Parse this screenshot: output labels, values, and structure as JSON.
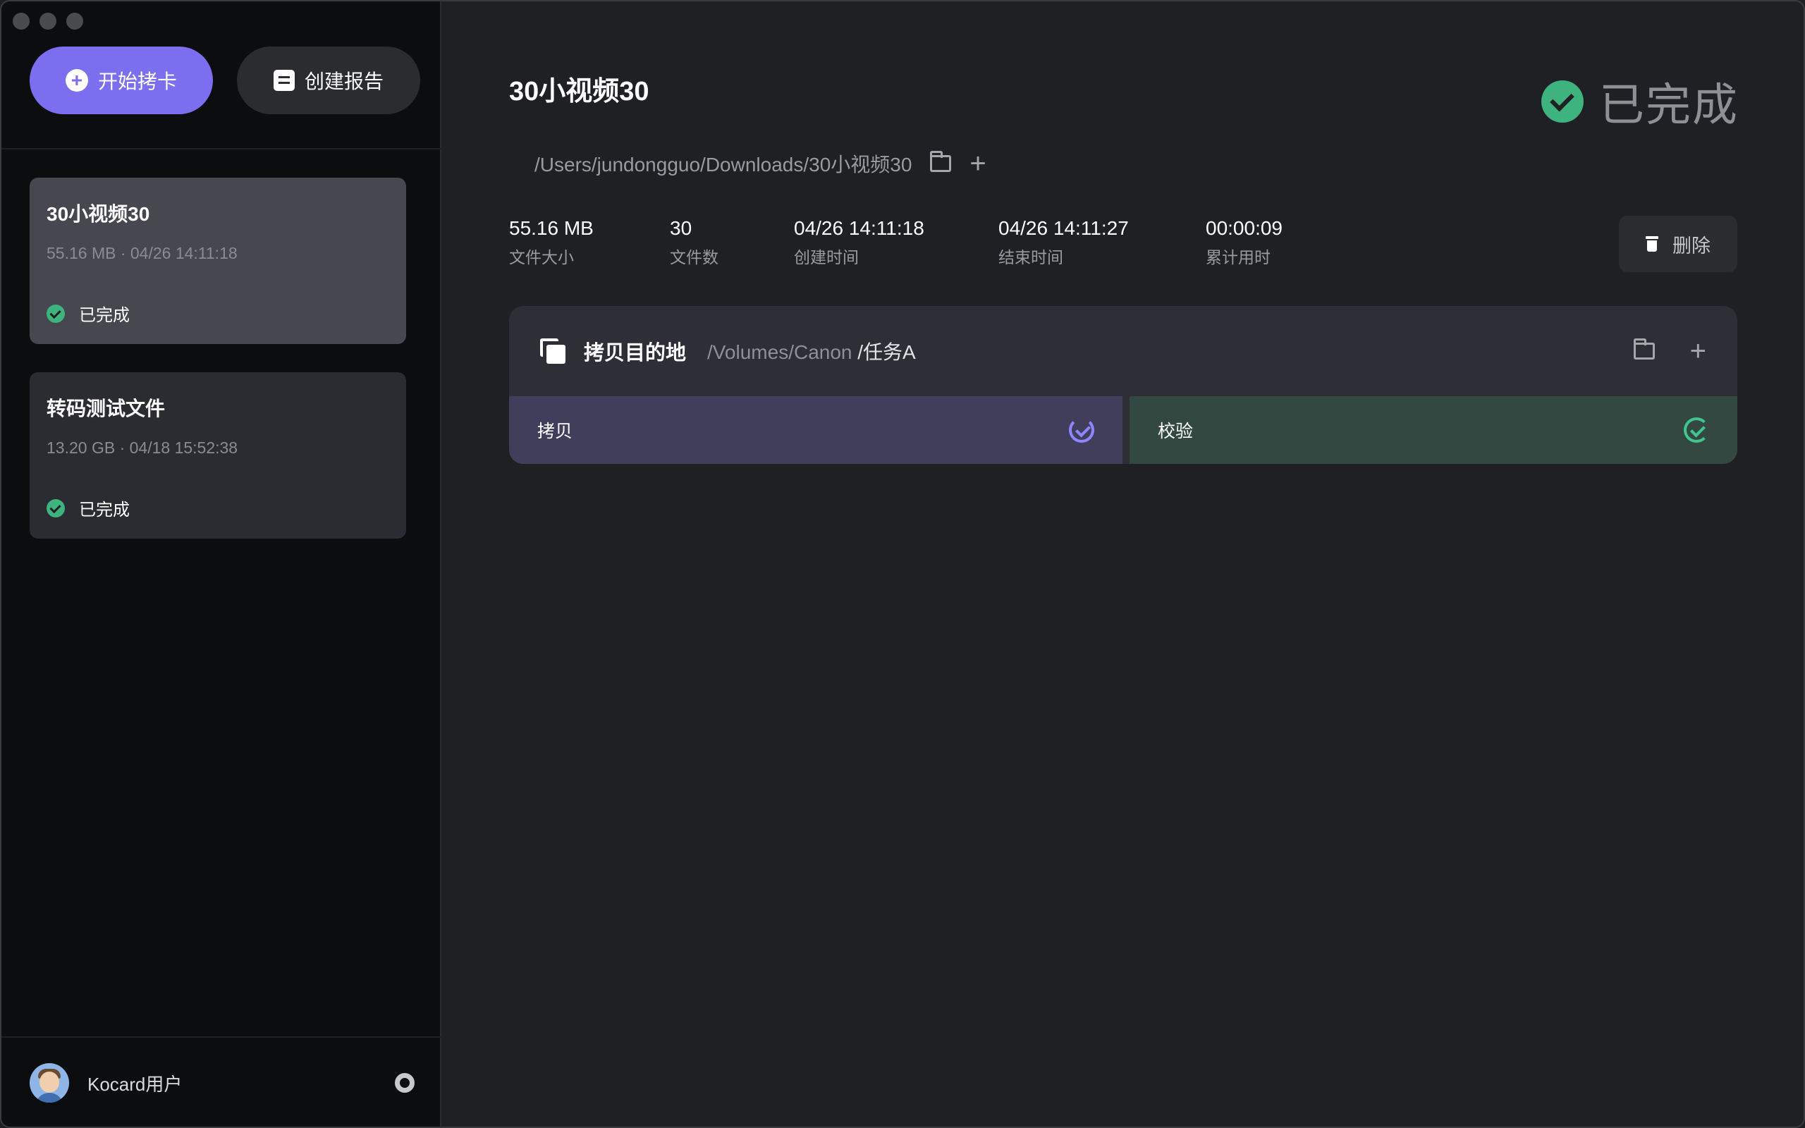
{
  "sidebar": {
    "start_button_label": "开始拷卡",
    "report_button_label": "创建报告",
    "tasks": [
      {
        "name": "30小视频30",
        "meta": "55.16 MB · 04/26 14:11:18",
        "status": "已完成"
      },
      {
        "name": "转码测试文件",
        "meta": "13.20 GB · 04/18 15:52:38",
        "status": "已完成"
      }
    ],
    "user_name": "Kocard用户"
  },
  "main": {
    "title": "30小视频30",
    "status": "已完成",
    "source_path": "/Users/jundongguo/Downloads/30小视频30",
    "stats": [
      {
        "value": "55.16 MB",
        "label": "文件大小"
      },
      {
        "value": "30",
        "label": "文件数"
      },
      {
        "value": "04/26 14:11:18",
        "label": "创建时间"
      },
      {
        "value": "04/26 14:11:27",
        "label": "结束时间"
      },
      {
        "value": "00:00:09",
        "label": "累计用时"
      }
    ],
    "delete_label": "删除",
    "destination": {
      "label": "拷贝目的地",
      "path_prefix": "/Volumes/Canon",
      "path_suffix": "/任务A",
      "copy_label": "拷贝",
      "verify_label": "校验"
    }
  },
  "colors": {
    "accent": "#7b6ff0",
    "success": "#3fb37f",
    "copy_bar": "#413e5c",
    "verify_bar": "#324840"
  }
}
